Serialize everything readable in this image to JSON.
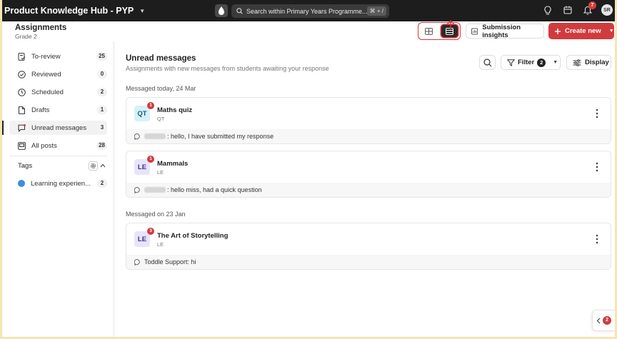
{
  "topbar": {
    "app_title": "Product Knowledge Hub - PYP",
    "search_placeholder": "Search within Primary Years Programme...",
    "search_shortcut": "⌘ + /",
    "notifications_count": "7",
    "user_initials": "SR"
  },
  "header": {
    "title": "Assignments",
    "subtitle": "Grade 2",
    "insights_label": "Submission insights",
    "create_label": "Create new"
  },
  "sidebar": {
    "items": [
      {
        "label": "To-review",
        "count": "25",
        "icon": "to-review-icon"
      },
      {
        "label": "Reviewed",
        "count": "0",
        "icon": "check-circle-icon"
      },
      {
        "label": "Scheduled",
        "count": "2",
        "icon": "clock-icon"
      },
      {
        "label": "Drafts",
        "count": "1",
        "icon": "document-icon"
      },
      {
        "label": "Unread messages",
        "count": "3",
        "icon": "message-icon"
      },
      {
        "label": "All posts",
        "count": "28",
        "icon": "posts-icon"
      }
    ],
    "tags_label": "Tags",
    "tags": [
      {
        "label": "Learning experien...",
        "count": "2",
        "color": "#3a8fde"
      }
    ]
  },
  "main": {
    "title": "Unread messages",
    "subtitle": "Assignments with new messages from students awaiting your response",
    "filter_label": "Filter",
    "filter_count": "2",
    "display_label": "Display",
    "groups": [
      {
        "label": "Messaged today, 24 Mar",
        "cards": [
          {
            "initials": "QT",
            "title": "Maths quiz",
            "code": "QT",
            "badge": "1",
            "message": ": hello, I have submitted my response"
          },
          {
            "initials": "LE",
            "title": "Mammals",
            "code": "LE",
            "badge": "1",
            "message": ": hello miss, had a quick question"
          }
        ]
      },
      {
        "label": "Messaged on 23 Jan",
        "cards": [
          {
            "initials": "LE",
            "title": "The Art of Storytelling",
            "code": "LE",
            "badge": "3",
            "sender": "Toddle Support",
            "message": " : hi"
          }
        ]
      }
    ]
  },
  "collapse_badge": "2",
  "colors": {
    "accent": "#d13b3e",
    "topbar": "#1d1d1d",
    "tag_blue": "#3a8fde"
  }
}
